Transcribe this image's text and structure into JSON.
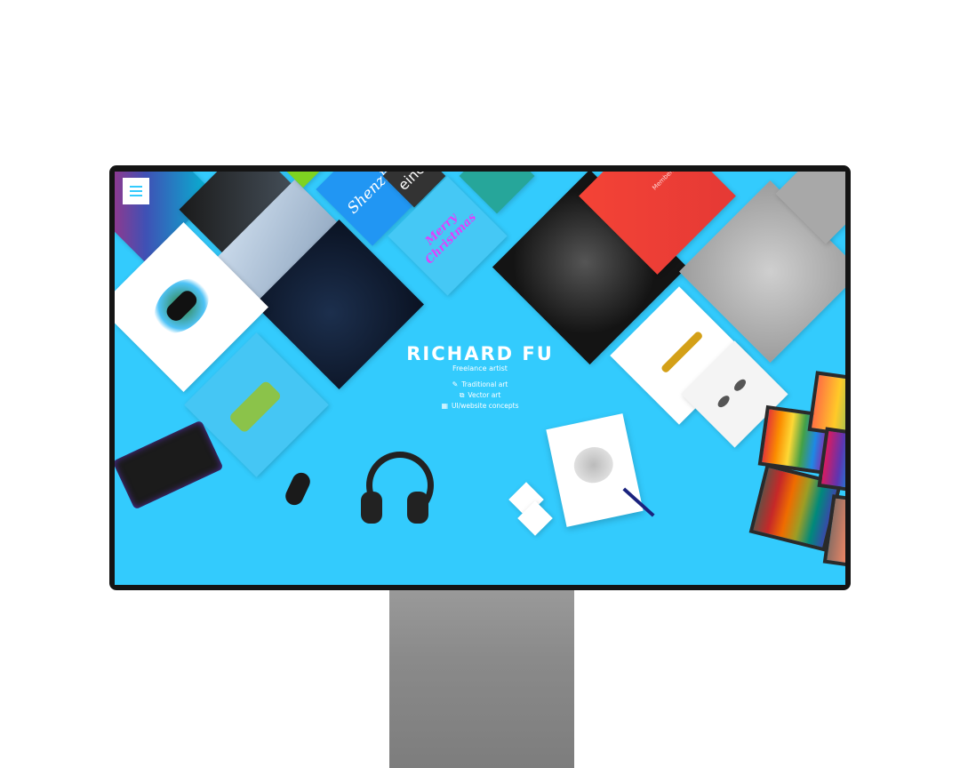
{
  "nav": {
    "menu_icon": "hamburger-icon"
  },
  "hero": {
    "title": "RICHARD FU",
    "subtitle": "Freelance artist"
  },
  "features": [
    {
      "label": "Traditional art",
      "icon": "pencil-icon"
    },
    {
      "label": "Vector art",
      "icon": "vector-shapes-icon"
    },
    {
      "label": "UI/website concepts",
      "icon": "layout-grid-icon"
    }
  ],
  "tiles": {
    "shenzhen": "Shenzhen",
    "christmas": "Merry Christmas",
    "eine": "eine",
    "members": "Members"
  },
  "colors": {
    "accent": "#33cbfd",
    "bezel": "#141414",
    "stand": "#8a8a8a"
  }
}
